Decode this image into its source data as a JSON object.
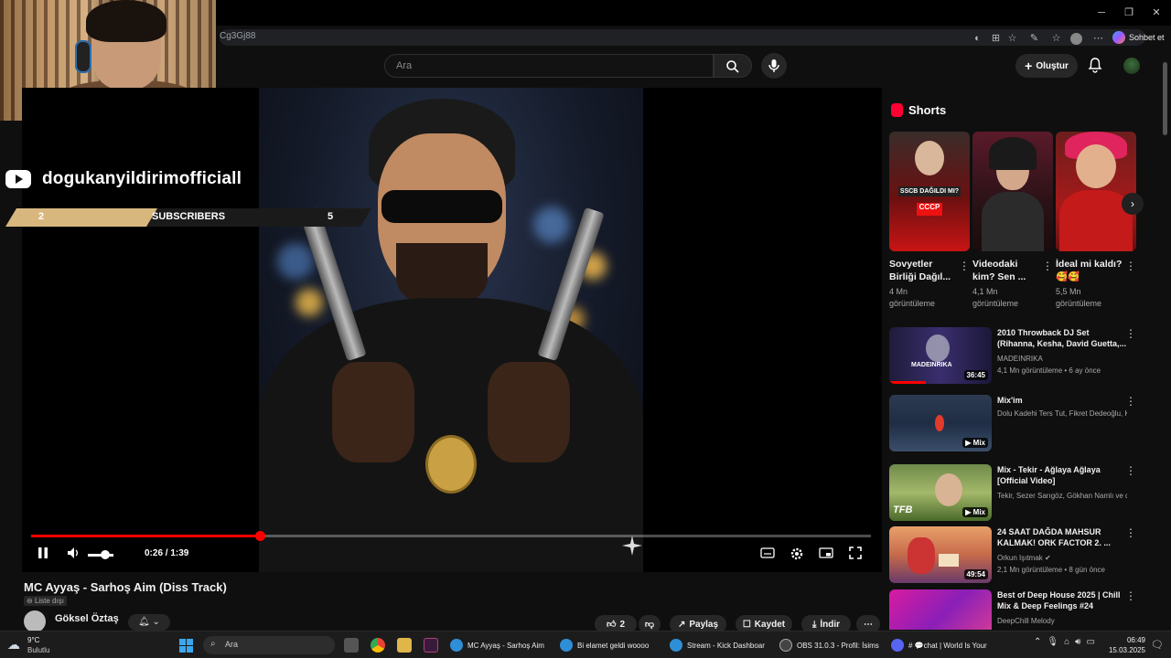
{
  "browser": {
    "url_fragment": "Cg3Gj88",
    "copilot_label": "Sohbet et"
  },
  "overlay": {
    "channel_name": "dogukanyildirimofficiall",
    "subs_count": "2",
    "subs_label": "SUBSCRIBERS",
    "subs_other": "5"
  },
  "header": {
    "search_placeholder": "Ara",
    "create_label": "Oluştur"
  },
  "player": {
    "time": "0:26 / 1:39",
    "progress": 0.272,
    "volume": 0.5
  },
  "video": {
    "title": "MC Ayyaş - Sarhoş Aim (Diss Track)",
    "visibility": "Liste dışı",
    "owner": "Göksel Öztaş",
    "likes": "2",
    "share_label": "Paylaş",
    "save_label": "Kaydet",
    "download_label": "İndir"
  },
  "shorts": {
    "header": "Shorts",
    "items": [
      {
        "title": "Sovyetler Birliği Dağıl...",
        "views": "4 Mn",
        "views_suffix": "görüntüleme",
        "overlay": "SSCB DAĞILDI MI?"
      },
      {
        "title": "Videodaki kim? Sen ...",
        "views": "4,1 Mn",
        "views_suffix": "görüntüleme",
        "overlay": ""
      },
      {
        "title": "İdeal mi kaldı? 🥰🥰",
        "views": "5,5 Mn",
        "views_suffix": "görüntüleme",
        "overlay": ""
      }
    ]
  },
  "recommendations": [
    {
      "title": "2010 Throwback DJ Set (Rihanna, Kesha, David Guetta,...",
      "channel": "MADEINRIKA",
      "meta": "4,1 Mn görüntüleme • 6 ay önce",
      "badge": "36:45",
      "thumb_text": "MADEINRIKA"
    },
    {
      "title": "Mix'im",
      "channel": "Dolu Kadehi Ters Tut, Fikret Dedeoğlu, Ka...",
      "meta": "",
      "badge": "Mix"
    },
    {
      "title": "Mix - Tekir - Ağlaya Ağlaya [Official Video]",
      "channel": "Tekir, Sezer Sarıgöz, Gökhan Namlı ve da...",
      "meta": "",
      "badge": "Mix",
      "thumb_text": "TFB"
    },
    {
      "title": "24 SAAT DAĞDA MAHSUR KALMAK! ORK FACTOR 2. ...",
      "channel": "Orkun Işıtmak",
      "meta": "2,1 Mn görüntüleme • 8 gün önce",
      "badge": "49:54"
    },
    {
      "title": "Best of Deep House 2025 | Chill Mix & Deep Feelings #24",
      "channel": "DeepChill Melody",
      "meta": "",
      "badge": ""
    }
  ],
  "taskbar": {
    "weather_temp": "9°C",
    "weather_desc": "Bulutlu",
    "search_placeholder": "Ara",
    "apps": [
      {
        "label": "MC Ayyaş - Sarhoş Aim",
        "color": "#2f8fd6",
        "active": true
      },
      {
        "label": "Bi elamet geldi woooo",
        "color": "#2f8fd6"
      },
      {
        "label": "Stream - Kick Dashboar",
        "color": "#2f8fd6"
      },
      {
        "label": "OBS 31.0.3 - Profil: İsims",
        "color": "#444"
      },
      {
        "label": "# 💬chat | World Is Your",
        "color": "#5865f2"
      }
    ],
    "time": "06:49",
    "date": "15.03.2025"
  },
  "colors": {
    "accent_red": "#ff0000",
    "gold": "#d8b77f",
    "youtube_dark": "#0f0f0f"
  }
}
